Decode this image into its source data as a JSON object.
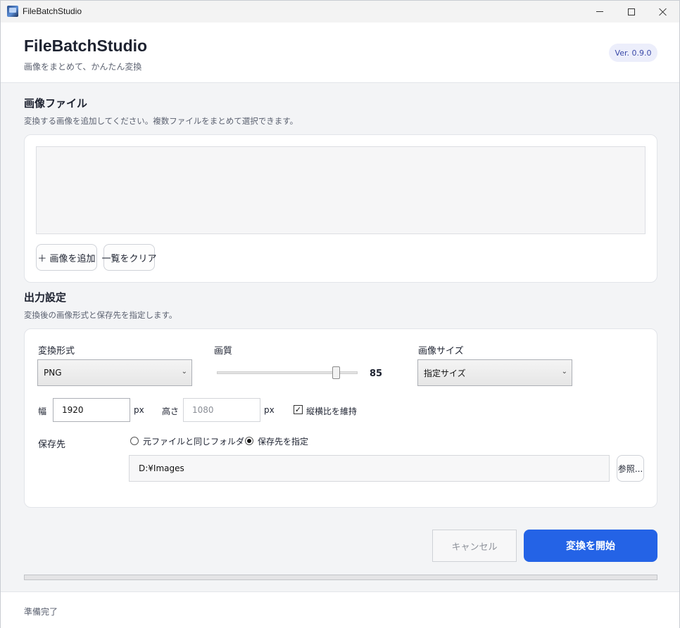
{
  "window": {
    "title": "FileBatchStudio"
  },
  "header": {
    "title": "FileBatchStudio",
    "subtitle": "画像をまとめて、かんたん変換",
    "version": "Ver. 0.9.0"
  },
  "files_section": {
    "title": "画像ファイル",
    "description": "変換する画像を追加してください。複数ファイルをまとめて選択できます。",
    "add_label": "＋ 画像を追加",
    "clear_label": "一覧をクリア"
  },
  "output_section": {
    "title": "出力設定",
    "description": "変換後の画像形式と保存先を指定します。",
    "format_label": "変換形式",
    "format_value": "PNG",
    "quality_label": "画質",
    "quality_value": "85",
    "quality_fraction": 0.85,
    "size_label": "画像サイズ",
    "size_value": "指定サイズ",
    "width_label": "幅",
    "width_value": "1920",
    "width_unit": "px",
    "height_label": "高さ",
    "height_value": "1080",
    "height_unit": "px",
    "keep_ratio_label": "縦横比を維持",
    "keep_ratio_checked": true,
    "save_label": "保存先",
    "radio_same_folder": "元ファイルと同じフォルダー",
    "radio_specify": "保存先を指定",
    "save_path": "D:¥Images",
    "browse_label": "参照..."
  },
  "actions": {
    "cancel_label": "キャンセル",
    "start_label": "変換を開始"
  },
  "progress": {
    "fraction": 0
  },
  "status": {
    "text": "準備完了"
  },
  "colors": {
    "accent": "#2463e6"
  }
}
